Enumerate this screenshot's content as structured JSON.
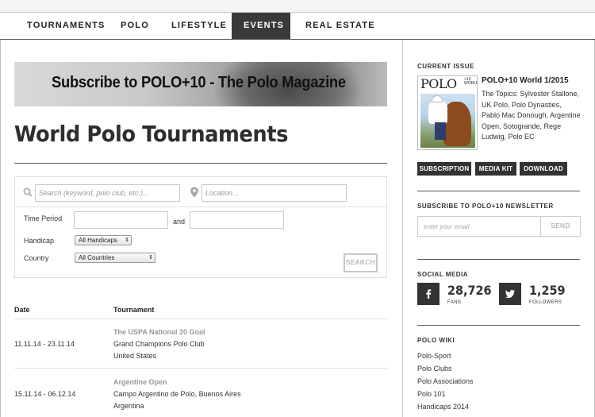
{
  "nav": {
    "items": [
      {
        "label": "TOURNAMENTS"
      },
      {
        "label": "POLO"
      },
      {
        "label": "LIFESTYLE"
      },
      {
        "label": "EVENTS",
        "active": true
      },
      {
        "label": "REAL ESTATE"
      }
    ]
  },
  "banner": {
    "text": "Subscribe to POLO+10 - The Polo Magazine"
  },
  "page": {
    "title": "World Polo Tournaments"
  },
  "search": {
    "keyword_placeholder": "Search (keyword, polo club, etc.)...",
    "location_placeholder": "Location...",
    "time_period_label": "Time Period",
    "and_label": "and",
    "handicap_label": "Handicap",
    "handicap_value": "All Handicaps",
    "country_label": "Country",
    "country_value": "All Countries",
    "search_button": "SEARCH"
  },
  "table": {
    "headers": [
      "Date",
      "Tournament"
    ],
    "rows": [
      {
        "date": "11.11.14 - 23.11.14",
        "name": "The USPA National 20 Goal",
        "club": "Grand Champions Polo Club",
        "country": "United States"
      },
      {
        "date": "15.11.14 - 06.12.14",
        "name": "Argentine Open",
        "club": "Campo Argentino de Polo, Buenos Aires",
        "country": "Argentina"
      }
    ]
  },
  "sidebar": {
    "current_issue": {
      "heading": "CURRENT ISSUE",
      "cover_logo": "POLO",
      "cover_sup": "+10 WORLD",
      "title": "POLO+10 World 1/2015",
      "description": "The Topics: Sylvester Stallone, UK Polo, Polo Dynasties, Pablo Mac Donough, Argentine Open, Sotogrande, Rege Ludwig, Polo EC",
      "buttons": [
        "SUBSCRIPTION",
        "MEDIA KIT",
        "DOWNLOAD"
      ]
    },
    "newsletter": {
      "heading": "SUBSCRIBE TO POLO+10 NEWSLETTER",
      "email_placeholder": "enter your email",
      "send_label": "SEND"
    },
    "social": {
      "heading": "SOCIAL MEDIA",
      "facebook": {
        "count": "28,726",
        "label": "FANS",
        "icon": "facebook-icon"
      },
      "twitter": {
        "count": "1,259",
        "label": "FOLLOWERS",
        "icon": "twitter-icon"
      }
    },
    "wiki": {
      "heading": "POLO WIKI",
      "links": [
        "Polo-Sport",
        "Polo Clubs",
        "Polo Associations",
        "Polo 101",
        "Handicaps 2014"
      ]
    }
  }
}
